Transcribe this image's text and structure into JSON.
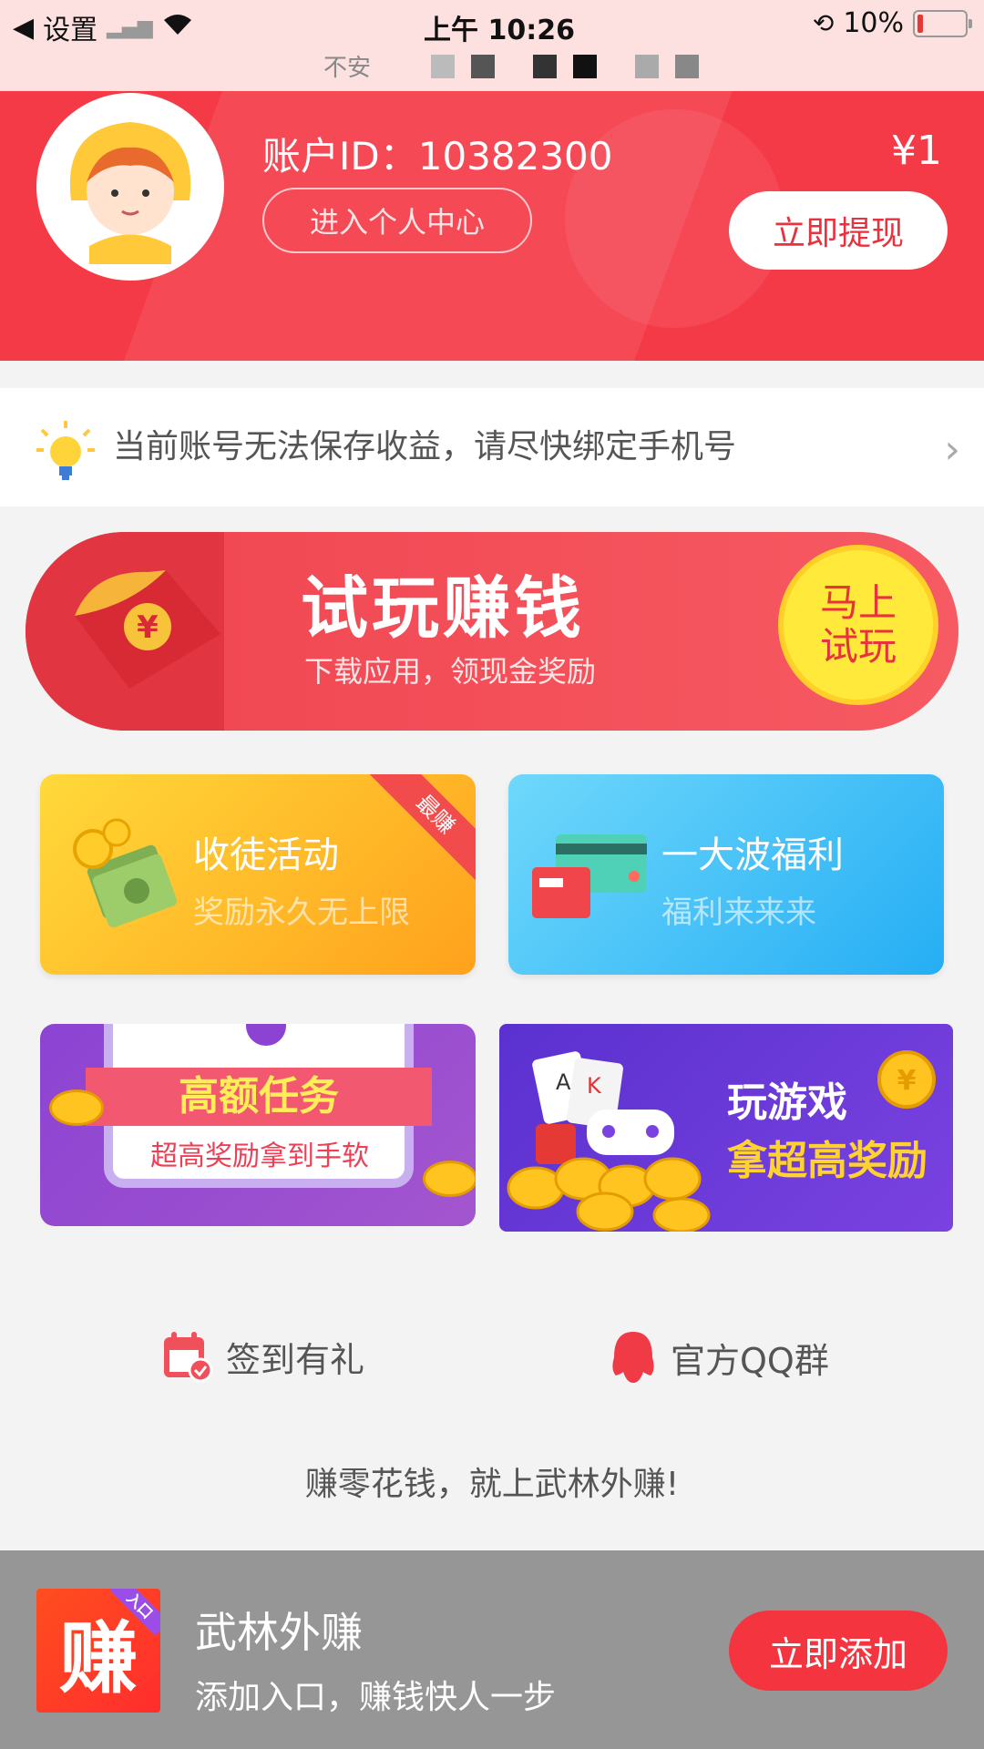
{
  "status_bar": {
    "back_label": "设置",
    "time": "上午 10:26",
    "battery": "10%",
    "battery_level": 0.1,
    "url": "不安"
  },
  "header": {
    "account_id": "账户ID：10382300",
    "personal_center": "进入个人中心",
    "balance": "¥1",
    "withdraw": "立即提现"
  },
  "notice": {
    "text": "当前账号无法保存收益，请尽快绑定手机号"
  },
  "try_banner": {
    "title": "试玩赚钱",
    "subtitle": "下载应用，领现金奖励",
    "button_line1": "马上",
    "button_line2": "试玩"
  },
  "cards": {
    "apprentice": {
      "title": "收徒活动",
      "subtitle": "奖励永久无上限",
      "badge": "最赚"
    },
    "welfare": {
      "title": "一大波福利",
      "subtitle": "福利来来来"
    }
  },
  "banners": {
    "task": {
      "title": "高额任务",
      "subtitle": "超高奖励拿到手软"
    },
    "game": {
      "line1": "玩游戏",
      "line2": "拿超高奖励"
    }
  },
  "quick_links": {
    "checkin": "签到有礼",
    "qq_group": "官方QQ群"
  },
  "slogan": "赚零花钱，就上武林外赚!",
  "add_bar": {
    "icon_text": "赚",
    "icon_badge": "入口",
    "app_name": "武林外赚",
    "app_desc": "添加入口，赚钱快人一步",
    "add_button": "立即添加"
  },
  "colors": {
    "primary_red": "#f53a47",
    "yellow": "#ffea3b",
    "bottom_bar": "#969696"
  }
}
